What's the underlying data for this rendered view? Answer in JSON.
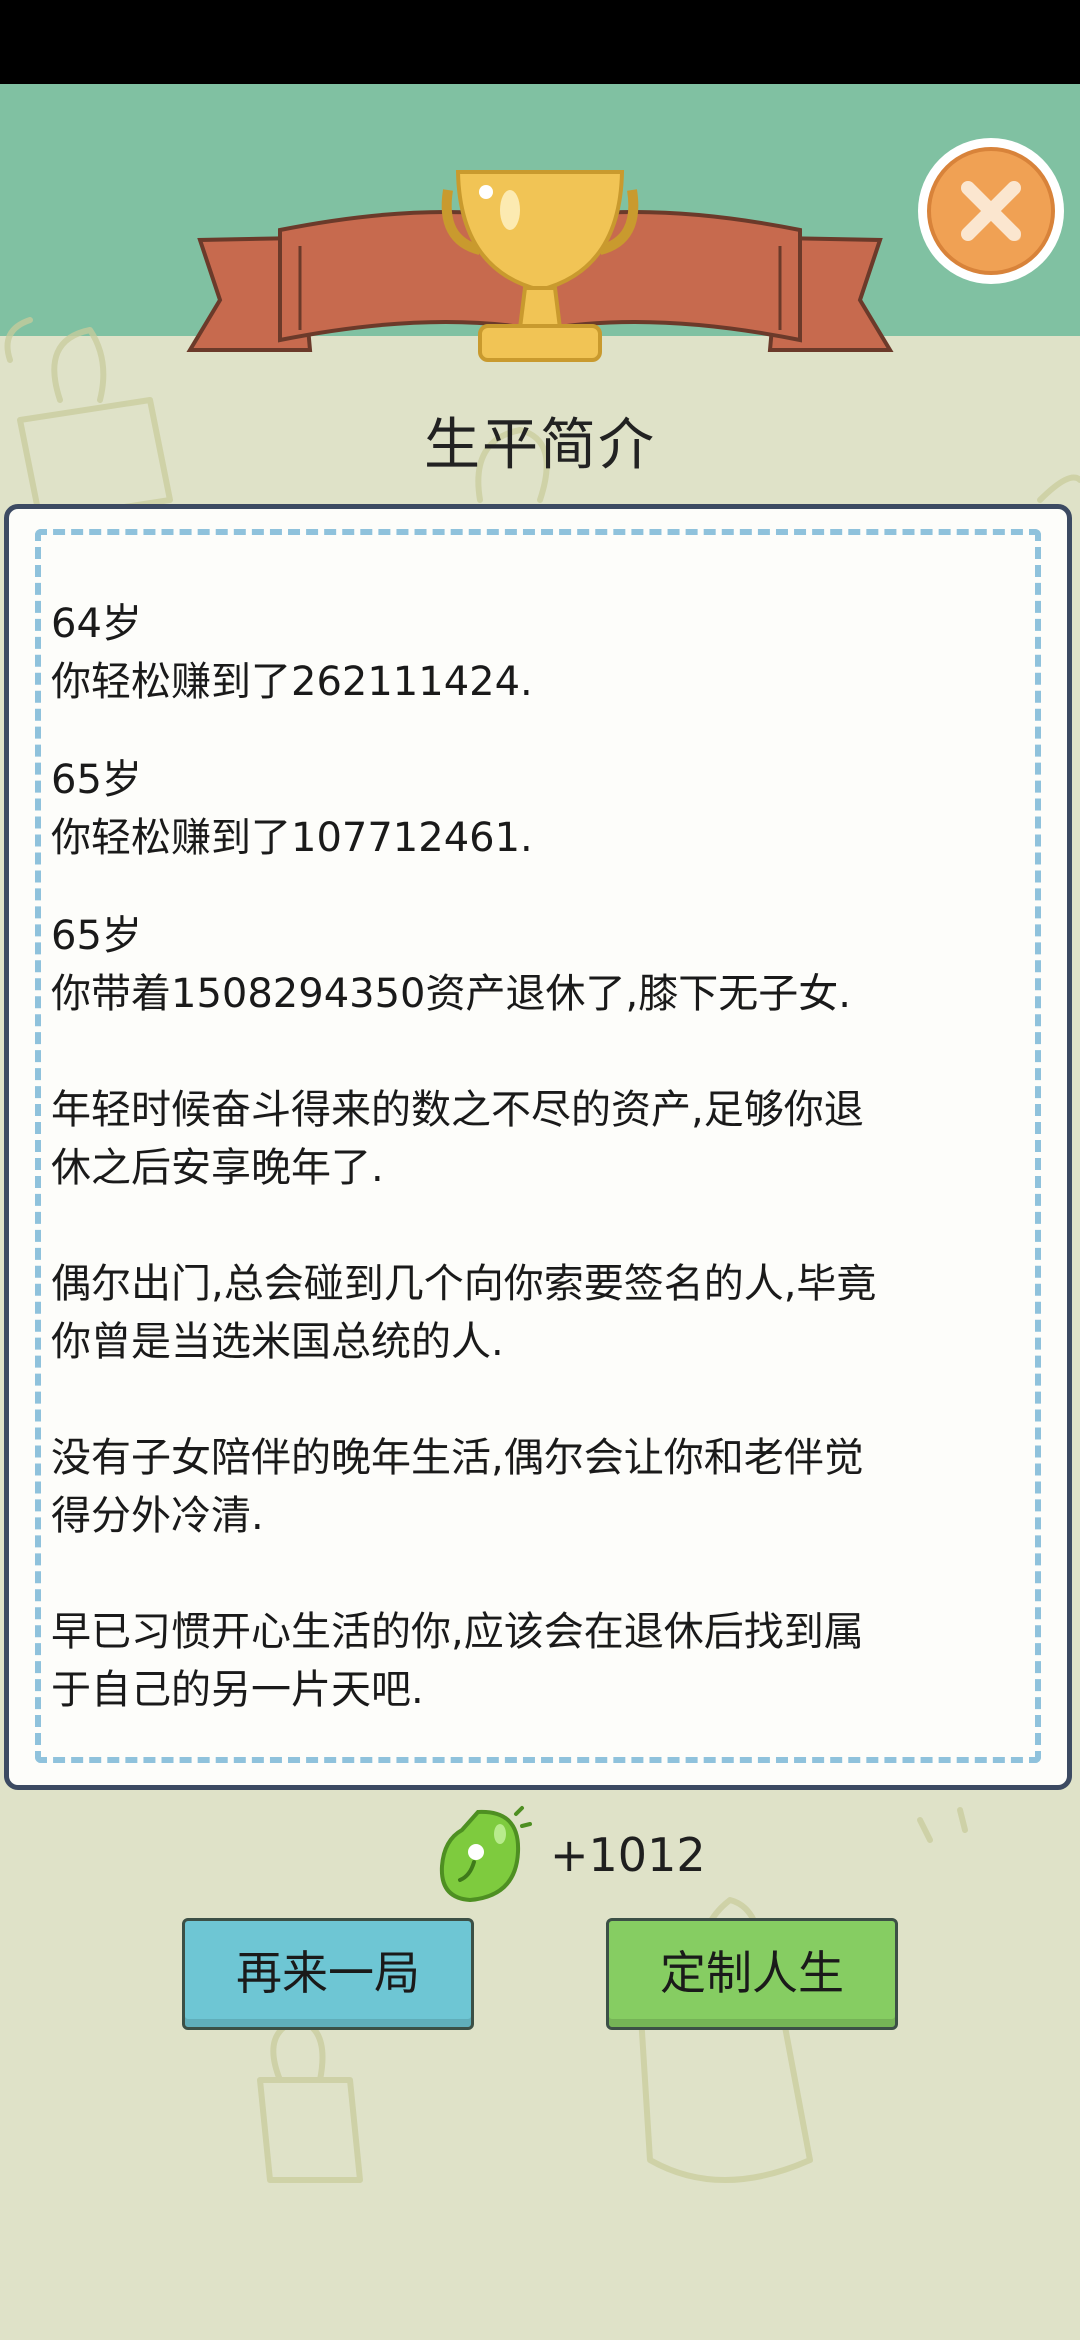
{
  "colors": {
    "header_band": "#80c1a2",
    "background": "#dfe2c8",
    "ribbon": "#c76a4e",
    "trophy": "#f1c455",
    "close_button": "#f0a154",
    "card_border": "#3c4a62",
    "card_dash": "#8fc2dc",
    "restart_button": "#6ec6d4",
    "custom_button": "#86cd62",
    "reward_icon": "#7ecb3e"
  },
  "header": {
    "trophy_icon": "trophy-icon",
    "close_icon": "close-icon"
  },
  "title": "生平简介",
  "entries": [
    {
      "lines": [
        "64岁",
        "你轻松赚到了262111424."
      ]
    },
    {
      "lines": [
        "65岁",
        "你轻松赚到了107712461."
      ]
    },
    {
      "lines": [
        "65岁",
        "你带着1508294350资产退休了,膝下无子女."
      ]
    }
  ],
  "paragraphs": [
    {
      "lines": [
        "年轻时候奋斗得来的数之不尽的资产,足够你退",
        "休之后安享晚年了."
      ]
    },
    {
      "lines": [
        "偶尔出门,总会碰到几个向你索要签名的人,毕竟",
        "你曾是当选米国总统的人."
      ]
    },
    {
      "lines": [
        "没有子女陪伴的晚年生活,偶尔会让你和老伴觉",
        "得分外冷清."
      ]
    },
    {
      "lines": [
        "早已习惯开心生活的你,应该会在退休后找到属",
        "于自己的另一片天吧."
      ]
    }
  ],
  "reward": {
    "icon": "green-bean-icon",
    "value": "+1012"
  },
  "buttons": {
    "restart": "再来一局",
    "customize": "定制人生"
  }
}
